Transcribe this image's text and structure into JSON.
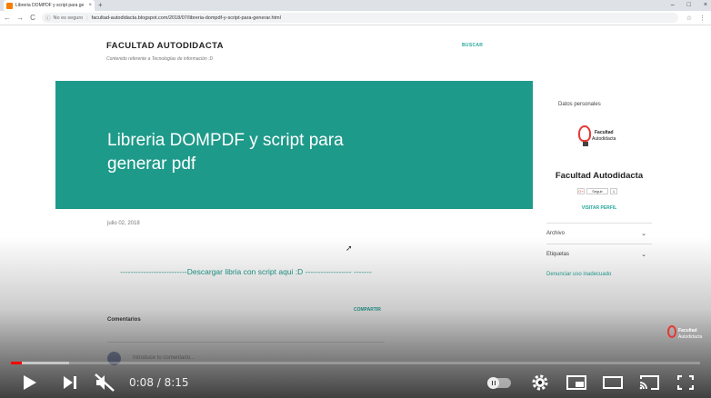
{
  "browser": {
    "tab_title": "Libreria DOMPDF y script para ge",
    "tab_close": "×",
    "new_tab": "+",
    "window_controls": [
      "–",
      "□",
      "×"
    ],
    "nav": [
      "←",
      "→",
      "C"
    ],
    "not_secure": "No es seguro",
    "url": "facultad-autodidacta.blogspot.com/2018/07/libreria-dompdf-y-script-para-generar.html"
  },
  "blog": {
    "title": "FACULTAD AUTODIDACTA",
    "description": "Contenido referente a Tecnologías de información :D",
    "search_label": "BUSCAR"
  },
  "post": {
    "title": "Libreria DOMPDF y script para generar pdf",
    "date": "julio 02, 2018",
    "download_text": "--------------------------Descargar libria con script aqui :D ------------------ -------",
    "share_label": "COMPARTIR",
    "comments_heading": "Comentarios",
    "comment_placeholder": "Introduce tu comentario..."
  },
  "sidebar": {
    "personal_title": "Datos personales",
    "logo_text_1": "Facultad",
    "logo_text_2": "Autodidacta",
    "profile_name": "Facultad Autodidacta",
    "gplus": "G+",
    "follow": "Seguir",
    "follow_count": "1",
    "visit_profile": "VISITAR PERFIL",
    "archive": "Archivo",
    "labels": "Etiquetas",
    "report": "Denunciar uso inadecuado"
  },
  "watermark": {
    "line1": "Facultad",
    "line2": "Autodidacta"
  },
  "player": {
    "time": "0:08 / 8:15",
    "progress_played_fraction": 0.016,
    "buffered_fraction": 0.085
  }
}
